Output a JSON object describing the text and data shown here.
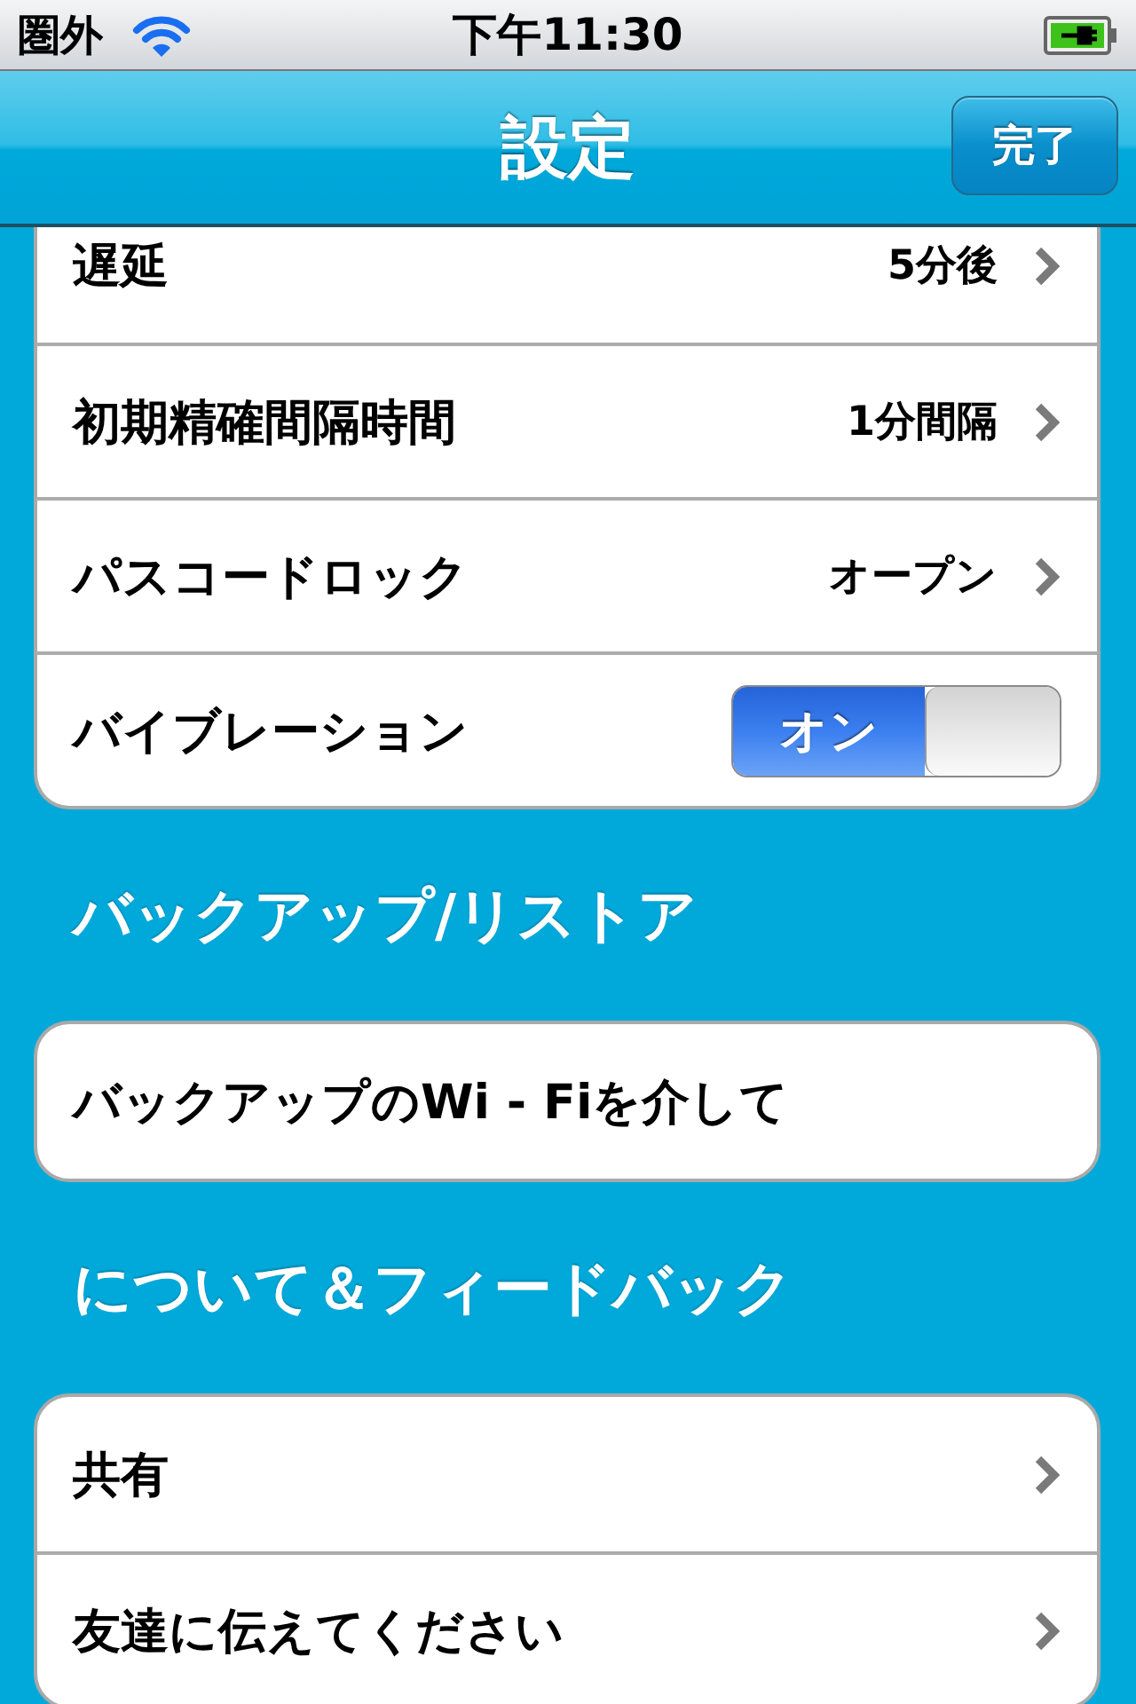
{
  "status_bar": {
    "carrier": "圏外",
    "time": "下午11:30"
  },
  "nav_bar": {
    "title": "設定",
    "done_button": "完了"
  },
  "sections": [
    {
      "rows": [
        {
          "kind": "link",
          "label": "遅延",
          "value": "5分後"
        },
        {
          "kind": "link",
          "label": "初期精確間隔時間",
          "value": "1分間隔"
        },
        {
          "kind": "link",
          "label": "パスコードロック",
          "value": "オープン"
        },
        {
          "kind": "switch",
          "label": "バイブレーション",
          "on": true,
          "switch_label": "オン"
        }
      ]
    },
    {
      "header": "バックアップ/リストア",
      "rows": [
        {
          "kind": "plain",
          "label": "バックアップのWi - Fiを介して"
        }
      ]
    },
    {
      "header": "について＆フィードバック",
      "rows": [
        {
          "kind": "link",
          "label": "共有"
        },
        {
          "kind": "link",
          "label": "友達に伝えてください"
        }
      ]
    }
  ]
}
